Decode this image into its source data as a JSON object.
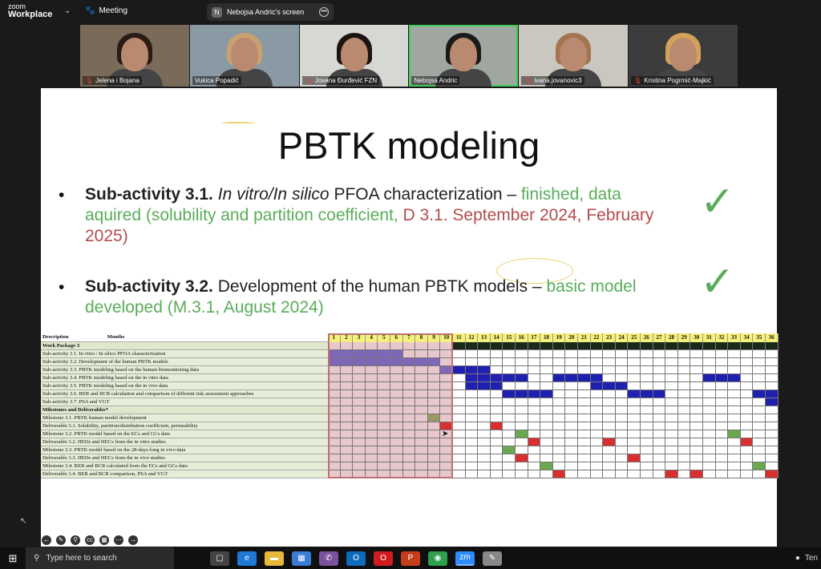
{
  "app": {
    "brand_line1": "zoom",
    "brand_line2": "Workplace",
    "meeting_label": "Meeting",
    "screen_label": "Nebojsa Andric's screen",
    "screen_initial": "N"
  },
  "participants": [
    {
      "name": "Jelena i Bojana",
      "muted": true,
      "active": false
    },
    {
      "name": "Vukica Popadić",
      "muted": false,
      "active": false
    },
    {
      "name": "Jovana Đurđević FZN",
      "muted": true,
      "active": false
    },
    {
      "name": "Nebojsa Andric",
      "muted": false,
      "active": true
    },
    {
      "name": "ivana.jovanovic3",
      "muted": true,
      "active": false
    },
    {
      "name": "Kristina Pogrmić-Majkić",
      "muted": true,
      "active": false
    }
  ],
  "slide": {
    "title": "PBTK modeling",
    "bullet1": {
      "bold": "Sub-activity 3.1.",
      "italic": "In vitro/In silico",
      "text": "PFOA characterization –",
      "green": "finished, data aquired (solubility and partition coefficient,",
      "red": "D 3.1. September 2024, February 2025)"
    },
    "bullet2": {
      "bold": "Sub-activity 3.2.",
      "text": "Development of the human PBTK models –",
      "green": "basic model developed (M.3.1, August 2024)"
    },
    "checkmark": "✓",
    "bullet_char": "•"
  },
  "gantt": {
    "header_desc": "Description",
    "header_months": "Months",
    "months": [
      1,
      2,
      3,
      4,
      5,
      6,
      7,
      8,
      9,
      10,
      11,
      12,
      13,
      14,
      15,
      16,
      17,
      18,
      19,
      20,
      21,
      22,
      23,
      24,
      25,
      26,
      27,
      28,
      29,
      30,
      31,
      32,
      33,
      34,
      35,
      36
    ],
    "rows": [
      {
        "label": "Work Package 3",
        "kind": "section",
        "cells": {}
      },
      {
        "label": "Sub-activity 3.1. In vitro / In silico  PFOA characterization",
        "kind": "task",
        "cells": {
          "purple": [
            1,
            2,
            3,
            4,
            5,
            6
          ]
        }
      },
      {
        "label": "Sub-activity 3.2. Development of the human PBTK models",
        "kind": "task",
        "cells": {
          "purple": [
            1,
            2,
            3,
            4,
            5,
            6,
            7,
            8,
            9
          ]
        }
      },
      {
        "label": "Sub-activity 3.3. PBTK modeling based on the human biomonitoring data",
        "kind": "task",
        "cells": {
          "purple": [
            10
          ],
          "blue": [
            11,
            12,
            13
          ]
        }
      },
      {
        "label": "Sub-activity 3.4. PBTK modeling based on the in vitro  data",
        "kind": "task",
        "cells": {
          "blue": [
            12,
            13,
            14,
            15,
            16,
            19,
            20,
            21,
            22,
            31,
            32,
            33
          ]
        }
      },
      {
        "label": "Sub-activity 3.5. PBTK modeling based on the in vivo  data",
        "kind": "task",
        "cells": {
          "blue": [
            12,
            13,
            14,
            22,
            23,
            24
          ]
        }
      },
      {
        "label": "Sub-activity 3.6. BER and BCR calculation and comparison of different risk assessment approaches",
        "kind": "task",
        "cells": {
          "blue": [
            15,
            16,
            17,
            18,
            25,
            26,
            27,
            35,
            36
          ]
        }
      },
      {
        "label": "Sub-activity 3.7. PSA and VGT",
        "kind": "task",
        "cells": {
          "blue": [
            36
          ]
        }
      },
      {
        "label": "Milestones and Deliverables*",
        "kind": "section",
        "cells": {}
      },
      {
        "label": "Milestone 3.1. PBTK human model development",
        "kind": "task",
        "cells": {
          "green": [
            9
          ]
        }
      },
      {
        "label": "Deliverable 3.1. Solubility, partition/distribution coefficient, permeability",
        "kind": "task",
        "cells": {
          "red": [
            10,
            14
          ]
        }
      },
      {
        "label": "Milestone 3.2. PBTK model based on the ECs and GCs data",
        "kind": "task",
        "cells": {
          "green": [
            16,
            33
          ]
        }
      },
      {
        "label": "Deliverable 3.2. HEDs and HECs from the in vitro  studies",
        "kind": "task",
        "cells": {
          "red": [
            17,
            23,
            34
          ]
        }
      },
      {
        "label": "Milestone 3.3. PBTK model based on the 28-days-long in vivo  data",
        "kind": "task",
        "cells": {
          "green": [
            15
          ]
        }
      },
      {
        "label": "Deliverable 3.3. HEDs and HECs from the in vivo  studies",
        "kind": "task",
        "cells": {
          "red": [
            16,
            25
          ]
        }
      },
      {
        "label": "Milestone 3.4. BER and BCR calculated from the ECs and GCs data",
        "kind": "task",
        "cells": {
          "green": [
            18,
            35
          ]
        }
      },
      {
        "label": "Deliverable 3.4. BER and BCR comparison, PSA and VGT",
        "kind": "task",
        "cells": {
          "red": [
            19,
            28,
            30,
            36
          ]
        }
      }
    ],
    "elapsed_months": 10
  },
  "colors": {
    "purple": "#8066b8",
    "blue": "#1f1fb0",
    "green": "#6aa84f",
    "red": "#d83030",
    "olive": "#9a9a62",
    "pink_fill": "#e8c8cc",
    "label_bg": "#e6eed8",
    "section_bg": "#dfe8cc"
  },
  "taskbar": {
    "search_placeholder": "Type here to search",
    "start_icon": "windows-icon",
    "apps": [
      "task-view-icon",
      "edge-icon",
      "file-explorer-icon",
      "store-icon",
      "viber-icon",
      "outlook-icon",
      "opera-icon",
      "powerpoint-icon",
      "chrome-icon",
      "zoom-icon",
      "paint-icon"
    ],
    "tray_text": "Ten"
  }
}
